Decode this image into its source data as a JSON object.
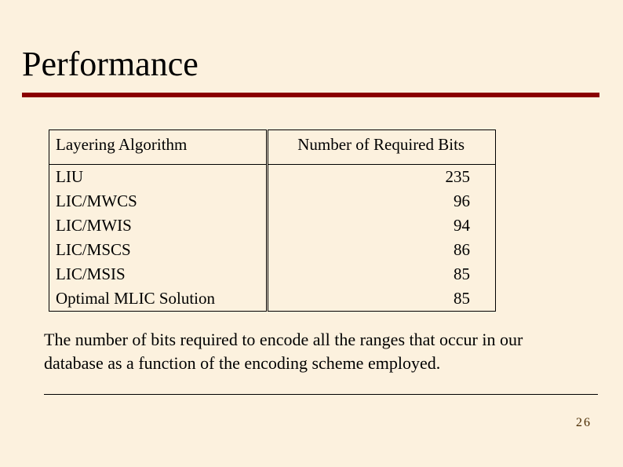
{
  "title": "Performance",
  "table": {
    "headers": {
      "col1": "Layering Algorithm",
      "col2": "Number of Required Bits"
    },
    "rows": [
      {
        "algo": "LIU",
        "bits": "235"
      },
      {
        "algo": "LIC/MWCS",
        "bits": "96"
      },
      {
        "algo": "LIC/MWIS",
        "bits": "94"
      },
      {
        "algo": "LIC/MSCS",
        "bits": "86"
      },
      {
        "algo": "LIC/MSIS",
        "bits": "85"
      },
      {
        "algo": "Optimal MLIC Solution",
        "bits": "85"
      }
    ]
  },
  "caption": "The number of bits required to encode all the ranges that occur in our database as a function of the encoding scheme employed.",
  "page_number": "26"
}
